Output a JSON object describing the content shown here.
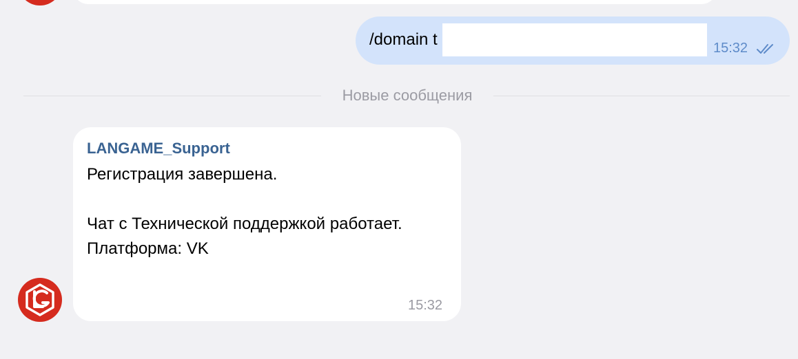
{
  "outgoing": {
    "text": "/domain t",
    "time": "15:32",
    "status_icon": "double-check-icon"
  },
  "separator": {
    "label": "Новые сообщения"
  },
  "incoming": {
    "sender": "LANGAME_Support",
    "lines": [
      "Регистрация завершена.",
      "Чат с Технической поддержкой работает.",
      "Платформа: VK"
    ],
    "time": "15:32",
    "avatar_icon": "langame-logo-icon"
  },
  "colors": {
    "background": "#f1f1f4",
    "outgoing_bubble": "#d3e3fb",
    "incoming_bubble": "#ffffff",
    "sender_name": "#3a6392",
    "avatar_red": "#d52b1e"
  }
}
